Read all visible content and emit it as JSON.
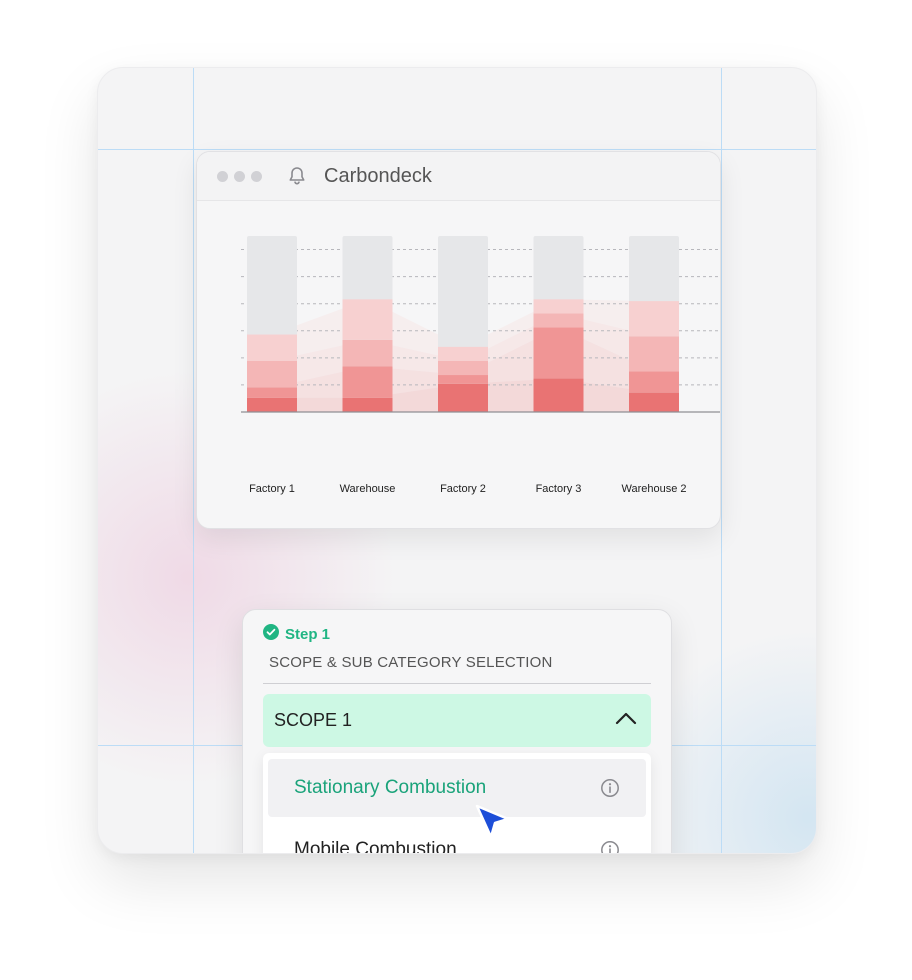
{
  "app": {
    "title": "Carbondeck"
  },
  "icons": {
    "bell": "bell-icon",
    "check": "check-circle-icon",
    "chevron": "chevron-up-icon",
    "info": "info-icon",
    "cursor": "cursor-arrow-icon"
  },
  "colors": {
    "accent_green": "#20b583",
    "scope_bg": "#cdf8e4",
    "cursor_blue": "#1d4ed8",
    "seg1": "#e97373",
    "seg2": "#f09595",
    "seg3": "#f4b6b6",
    "seg4": "#f7d0d0",
    "empty": "#e6e7e9"
  },
  "chart_data": {
    "type": "bar",
    "stacked": true,
    "categories": [
      "Factory 1",
      "Warehouse",
      "Factory 2",
      "Factory 3",
      "Warehouse 2"
    ],
    "series": [
      {
        "values": [
          8,
          8,
          16,
          19,
          11
        ]
      },
      {
        "values": [
          6,
          18,
          5,
          29,
          12
        ]
      },
      {
        "values": [
          15,
          15,
          8,
          8,
          20
        ]
      },
      {
        "values": [
          15,
          23,
          8,
          8,
          20
        ]
      }
    ],
    "total": 100,
    "ylim": [
      0,
      100
    ],
    "grid": true,
    "legend": "none"
  },
  "panel": {
    "step_label": "Step 1",
    "section_title": "SCOPE & SUB CATEGORY SELECTION",
    "scope_label": "SCOPE 1",
    "options": [
      {
        "label": "Stationary Combustion",
        "selected": true
      },
      {
        "label": "Mobile Combustion",
        "selected": false
      }
    ]
  }
}
